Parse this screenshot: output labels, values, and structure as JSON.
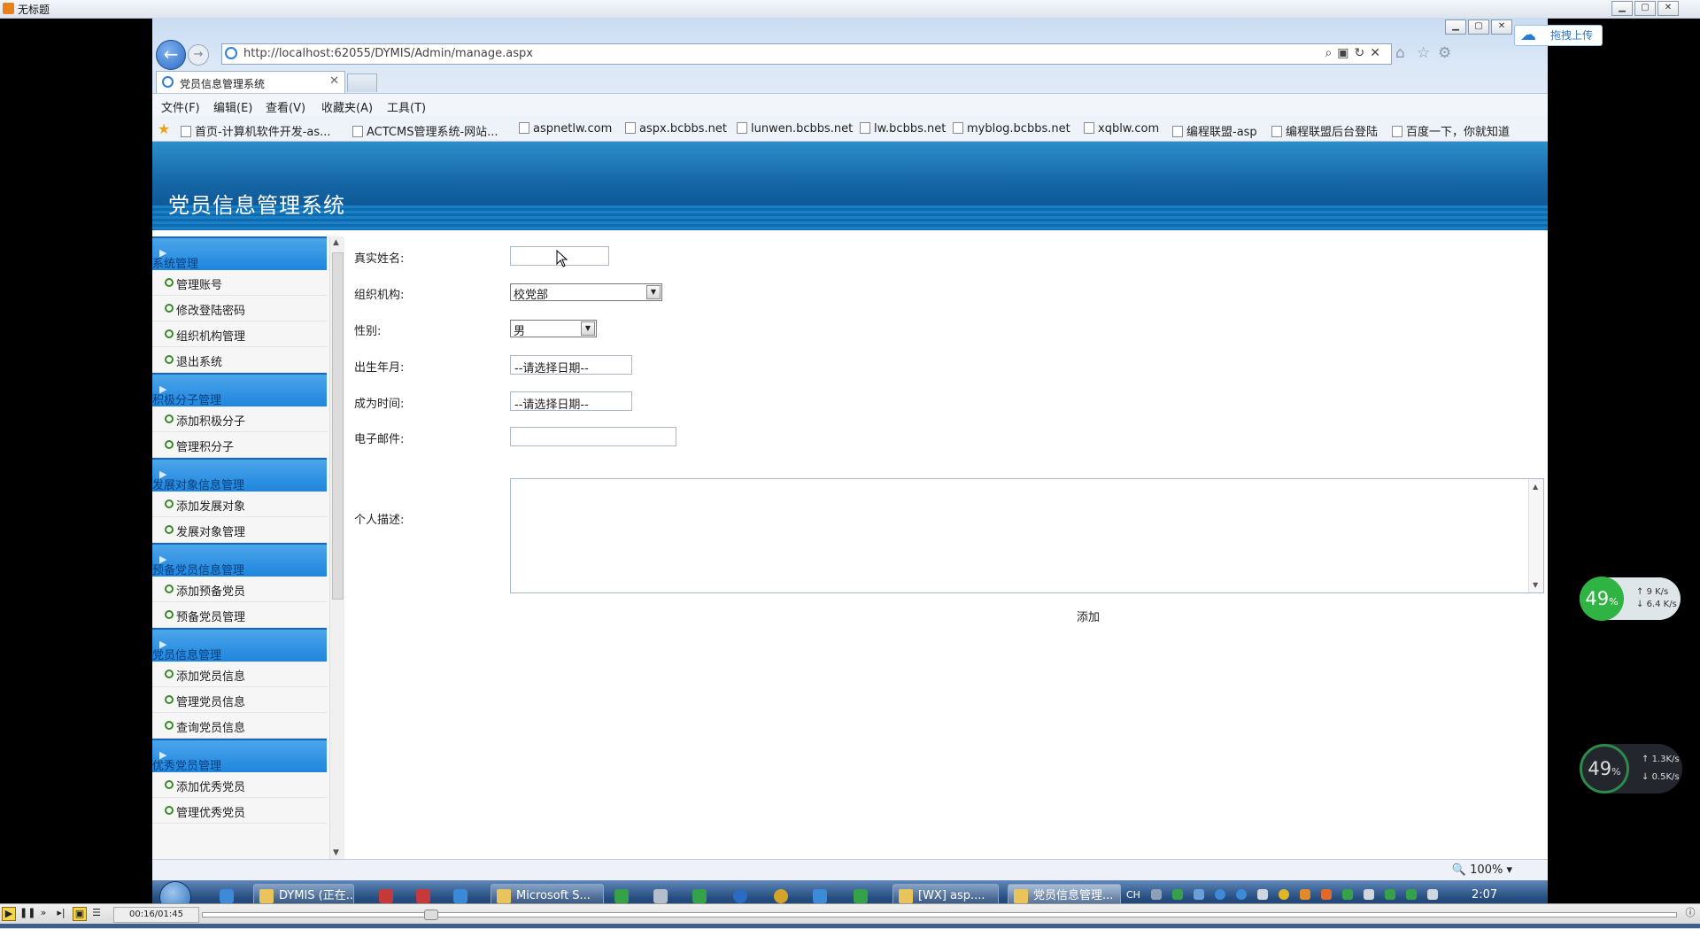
{
  "player_window": {
    "title": "无标题",
    "time": "00:16/01:45"
  },
  "browser": {
    "address": "http://localhost:62055/DYMIS/Admin/manage.aspx",
    "tab_title": "党员信息管理系统",
    "menu": [
      "文件(F)",
      "编辑(E)",
      "查看(V)",
      "收藏夹(A)",
      "工具(T)"
    ],
    "favorites": [
      "首页-计算机软件开发-as...",
      "ACTCMS管理系统-网站...",
      "aspnetlw.com",
      "aspx.bcbbs.net",
      "lunwen.bcbbs.net",
      "lw.bcbbs.net",
      "myblog.bcbbs.net",
      "xqblw.com",
      "编程联盟-asp",
      "编程联盟后台登陆",
      "百度一下，你就知道"
    ],
    "zoom": "100%",
    "upload_label": "拖拽上传"
  },
  "page": {
    "title": "党员信息管理系统"
  },
  "sidebar": {
    "sections": [
      {
        "label": "系统管理",
        "items": [
          "管理账号",
          "修改登陆密码",
          "组织机构管理",
          "退出系统"
        ]
      },
      {
        "label": "积极分子管理",
        "items": [
          "添加积极分子",
          "管理积分子"
        ]
      },
      {
        "label": "发展对象信息管理",
        "items": [
          "添加发展对象",
          "发展对象管理"
        ]
      },
      {
        "label": "预备党员信息管理",
        "items": [
          "添加预备党员",
          "预备党员管理"
        ]
      },
      {
        "label": "党员信息管理",
        "items": [
          "添加党员信息",
          "管理党员信息",
          "查询党员信息"
        ]
      },
      {
        "label": "优秀党员管理",
        "items": [
          "添加优秀党员",
          "管理优秀党员"
        ]
      }
    ]
  },
  "form": {
    "name_label": "真实姓名:",
    "name_value": "",
    "org_label": "组织机构:",
    "org_value": "校党部",
    "gender_label": "性别:",
    "gender_value": "男",
    "birth_label": "出生年月:",
    "birth_value": "--请选择日期--",
    "join_label": "成为时间:",
    "join_value": "--请选择日期--",
    "email_label": "电子邮件:",
    "email_value": "",
    "desc_label": "个人描述:",
    "submit_label": "添加"
  },
  "taskbar": {
    "items": [
      "DYMIS (正在...",
      "Microsoft S...",
      "[WX] asp....",
      "党员信息管理..."
    ],
    "tray_lang": "CH",
    "clock": "2:07"
  },
  "widgets": {
    "cpu_top": "49",
    "up_top": "9 K/s",
    "down_top": "6.4 K/s",
    "cpu_bottom": "49",
    "up_bottom": "1.3K/s",
    "down_bottom": "0.5K/s"
  }
}
